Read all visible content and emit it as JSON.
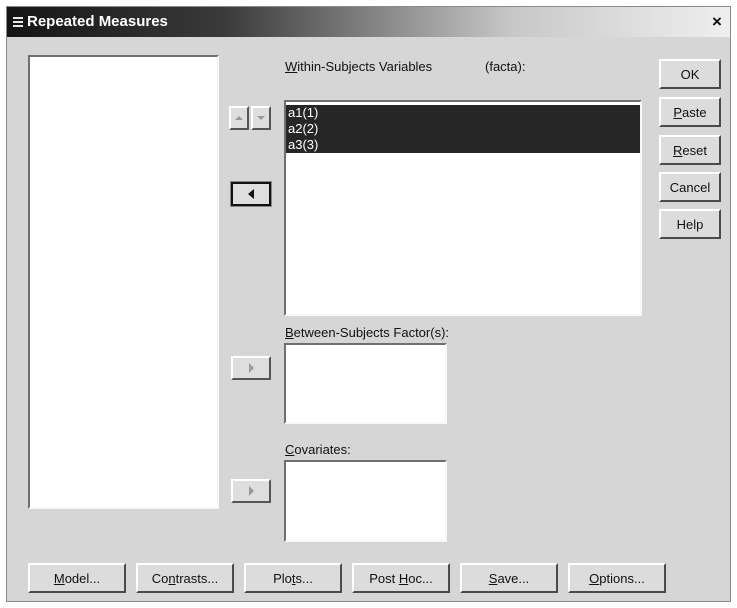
{
  "window": {
    "title": "Repeated Measures",
    "close_glyph": "×"
  },
  "within": {
    "label_prefix": "W",
    "label_rest": "ithin-Subjects Variables",
    "factor": "(facta):",
    "items": [
      "a1(1)",
      "a2(2)",
      "a3(3)"
    ]
  },
  "between": {
    "label_prefix": "B",
    "label_rest": "etween-Subjects Factor(s):"
  },
  "covariates": {
    "label_prefix": "C",
    "label_rest": "ovariates:"
  },
  "side_buttons": {
    "ok": "OK",
    "paste_u": "P",
    "paste_rest": "aste",
    "reset_u": "R",
    "reset_rest": "eset",
    "cancel": "Cancel",
    "help": "Help"
  },
  "bottom_buttons": {
    "model_u": "M",
    "model_rest": "odel...",
    "contrasts_a": "Co",
    "contrasts_u": "n",
    "contrasts_rest": "trasts...",
    "plots_a": "Plo",
    "plots_u": "t",
    "plots_rest": "s...",
    "posthoc_a": "Post ",
    "posthoc_u": "H",
    "posthoc_rest": "oc...",
    "save_u": "S",
    "save_rest": "ave...",
    "options_u": "O",
    "options_rest": "ptions..."
  },
  "icons": {
    "move_up": "triangle-up",
    "move_down": "triangle-down",
    "move_left": "triangle-left",
    "move_right": "triangle-right"
  }
}
